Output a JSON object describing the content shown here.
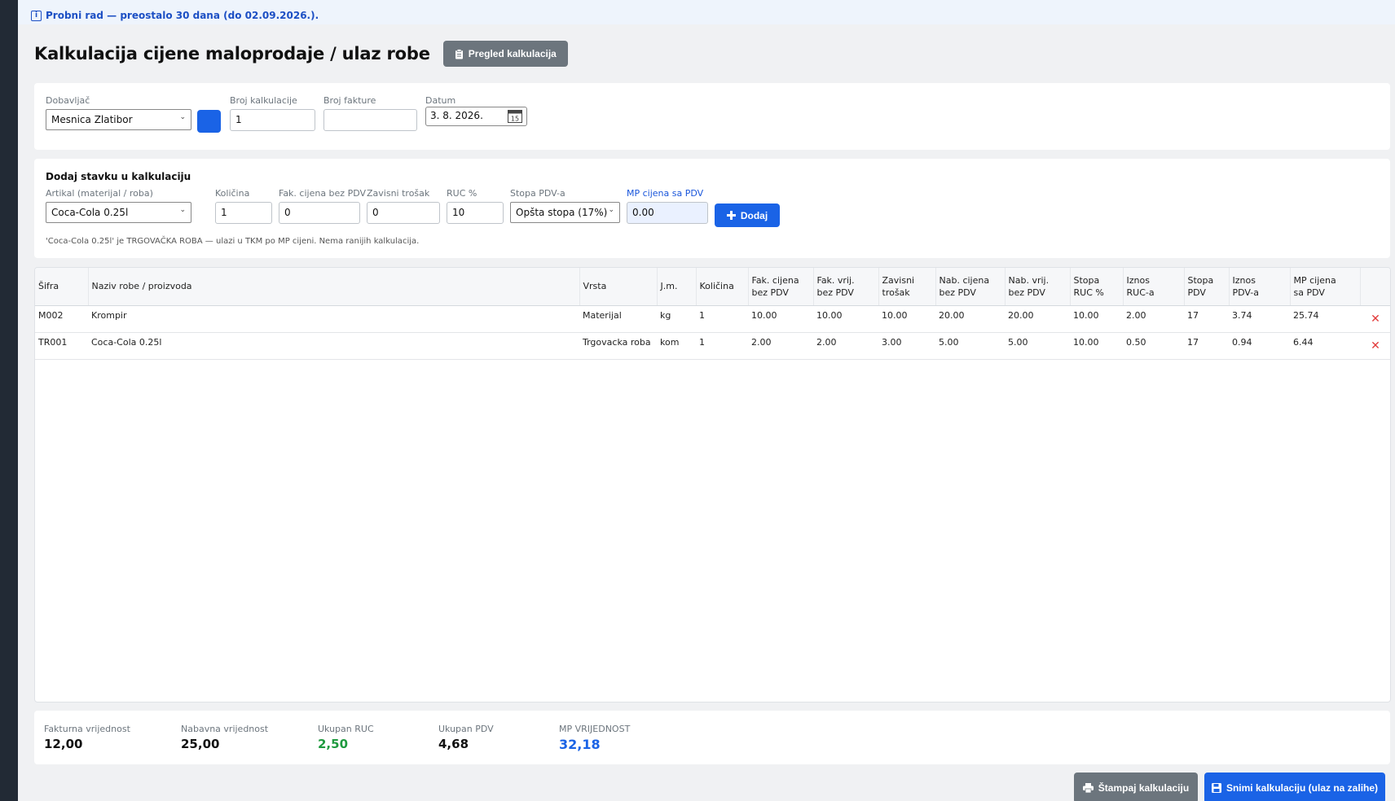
{
  "trial_banner": "Probni rad — preostalo 30 dana (do 02.09.2026.).",
  "page_title": "Kalkulacija cijene maloprodaje / ulaz robe",
  "review_button": "Pregled kalkulacija",
  "header_form": {
    "supplier_label": "Dobavljač",
    "supplier_value": "Mesnica Zlatibor",
    "calc_no_label": "Broj kalkulacije",
    "calc_no_value": "1",
    "invoice_no_label": "Broj fakture",
    "invoice_no_value": "",
    "date_label": "Datum",
    "date_value": "3. 8. 2026."
  },
  "add_item": {
    "section_title": "Dodaj stavku u kalkulaciju",
    "article_label": "Artikal (materijal / roba)",
    "article_value": "Coca-Cola 0.25l",
    "qty_label": "Količina",
    "qty_value": "1",
    "price_label": "Fak. cijena bez PDV",
    "price_value": "0",
    "cost_label": "Zavisni trošak",
    "cost_value": "0",
    "ruc_label": "RUC %",
    "ruc_value": "10",
    "vat_label": "Stopa PDV-a",
    "vat_value": "Opšta stopa (17%)",
    "mp_label": "MP cijena sa PDV",
    "mp_value": "0.00",
    "add_button": "Dodaj",
    "hint": "'Coca-Cola 0.25l' je TRGOVAČKA ROBA — ulazi u TKM po MP cijeni. Nema ranijih kalkulacija."
  },
  "table": {
    "headers": [
      [
        "Šifra",
        ""
      ],
      [
        "Naziv robe / proizvoda",
        ""
      ],
      [
        "Vrsta",
        ""
      ],
      [
        "J.m.",
        ""
      ],
      [
        "Količina",
        ""
      ],
      [
        "Fak. cijena",
        "bez PDV"
      ],
      [
        "Fak. vrij.",
        "bez PDV"
      ],
      [
        "Zavisni",
        "trošak"
      ],
      [
        "Nab. cijena",
        "bez PDV"
      ],
      [
        "Nab. vrij.",
        "bez PDV"
      ],
      [
        "Stopa",
        "RUC %"
      ],
      [
        "Iznos",
        "RUC-a"
      ],
      [
        "Stopa",
        "PDV"
      ],
      [
        "Iznos",
        "PDV-a"
      ],
      [
        "MP cijena",
        "sa PDV"
      ]
    ],
    "rows": [
      [
        "M002",
        "Krompir",
        "Materijal",
        "kg",
        "1",
        "10.00",
        "10.00",
        "10.00",
        "20.00",
        "20.00",
        "10.00",
        "2.00",
        "17",
        "3.74",
        "25.74"
      ],
      [
        "TR001",
        "Coca-Cola 0.25l",
        "Trgovacka roba",
        "kom",
        "1",
        "2.00",
        "2.00",
        "3.00",
        "5.00",
        "5.00",
        "10.00",
        "0.50",
        "17",
        "0.94",
        "6.44"
      ]
    ]
  },
  "totals": {
    "invoice_label": "Fakturna vrijednost",
    "invoice_value": "12,00",
    "purchase_label": "Nabavna vrijednost",
    "purchase_value": "25,00",
    "ruc_label": "Ukupan RUC",
    "ruc_value": "2,50",
    "vat_label": "Ukupan PDV",
    "vat_value": "4,68",
    "mp_label": "MP VRIJEDNOST",
    "mp_value": "32,18"
  },
  "print_button": "Štampaj kalkulaciju",
  "save_button": "Snimi kalkulaciju (ulaz na zalihe)",
  "colors": {
    "primary": "#1a63e6",
    "secondary": "#6c757d",
    "danger": "#e23a3a",
    "success": "#1f9a3f",
    "sidebar": "#222a35"
  },
  "icons": [
    "info-icon",
    "clipboard-icon",
    "chevron-down-icon",
    "calendar-icon",
    "plus-icon",
    "close-icon",
    "printer-icon",
    "floppy-disk-icon"
  ]
}
